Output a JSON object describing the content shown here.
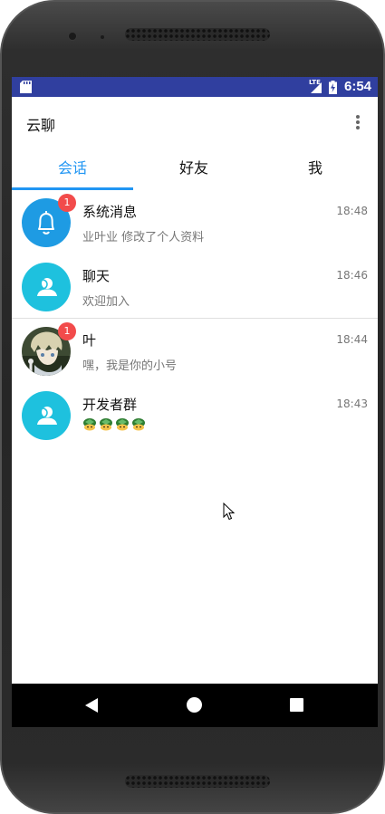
{
  "status_bar": {
    "network": "LTE",
    "time": "6:54"
  },
  "app_bar": {
    "title": "云聊",
    "menu_icon": "more-vert-icon"
  },
  "tabs": [
    {
      "label": "会话",
      "active": true
    },
    {
      "label": "好友",
      "active": false
    },
    {
      "label": "我",
      "active": false
    }
  ],
  "colors": {
    "status_bar": "#303f9f",
    "accent": "#2196f3",
    "badge": "#f24b4b",
    "avatar_blue": "#1e9be3",
    "avatar_cyan": "#1ec1de"
  },
  "conversations": [
    {
      "title": "系统消息",
      "time": "18:48",
      "preview": "业叶业 修改了个人资料",
      "badge": "1",
      "avatar": "bell-icon"
    },
    {
      "title": "聊天",
      "time": "18:46",
      "preview": "欢迎加入",
      "badge": "",
      "avatar": "user-group-icon"
    },
    {
      "title": "叶",
      "time": "18:44",
      "preview": "嘿，我是你的小号",
      "badge": "1",
      "avatar": "user-photo"
    },
    {
      "title": "开发者群",
      "time": "18:43",
      "preview": "",
      "badge": "",
      "avatar": "user-group-icon",
      "emoji_count": 4
    }
  ],
  "nav_bar": {
    "back": "back-icon",
    "home": "home-icon",
    "recents": "recents-icon"
  }
}
